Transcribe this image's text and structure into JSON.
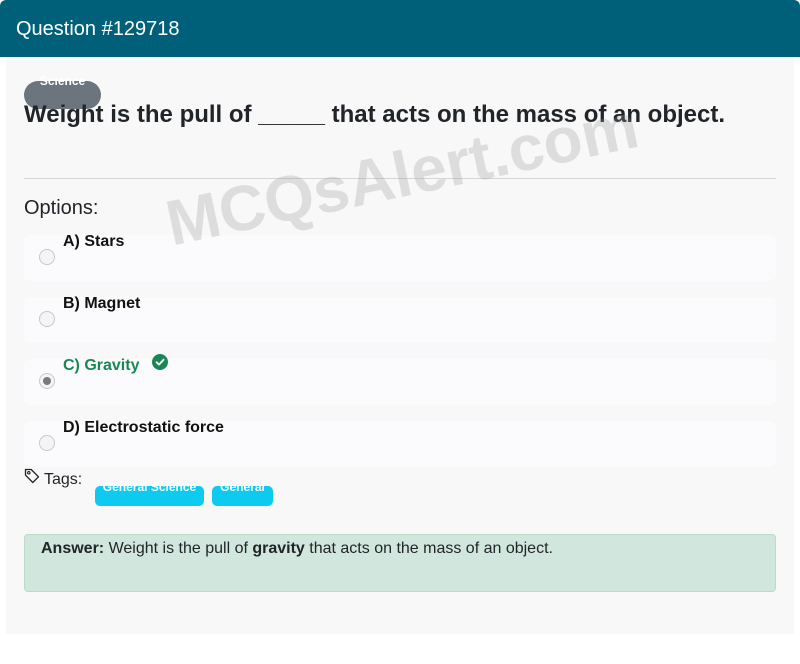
{
  "header": {
    "title": "Question #129718"
  },
  "question": {
    "category": "Science",
    "text": "Weight is the pull of _____ that acts on the mass of an object."
  },
  "options_label": "Options:",
  "options": [
    {
      "label": "A) Stars",
      "selected": false,
      "correct": false
    },
    {
      "label": "B) Magnet",
      "selected": false,
      "correct": false
    },
    {
      "label": "C) Gravity",
      "selected": true,
      "correct": true
    },
    {
      "label": "D) Electrostatic force",
      "selected": false,
      "correct": false
    }
  ],
  "watermark": "MCQsAlert.com",
  "tags": {
    "label": "Tags:",
    "items": [
      "General Science",
      "General"
    ]
  },
  "answer": {
    "prefix": "Answer:",
    "before": " Weight is the pull of ",
    "key": "gravity",
    "after": " that acts on the mass of an object."
  },
  "colors": {
    "header_bg": "#00607a",
    "correct": "#198754",
    "tag_bg": "#0dcaf0",
    "answer_bg": "#d1e7dd",
    "badge_bg": "#6c757d"
  }
}
